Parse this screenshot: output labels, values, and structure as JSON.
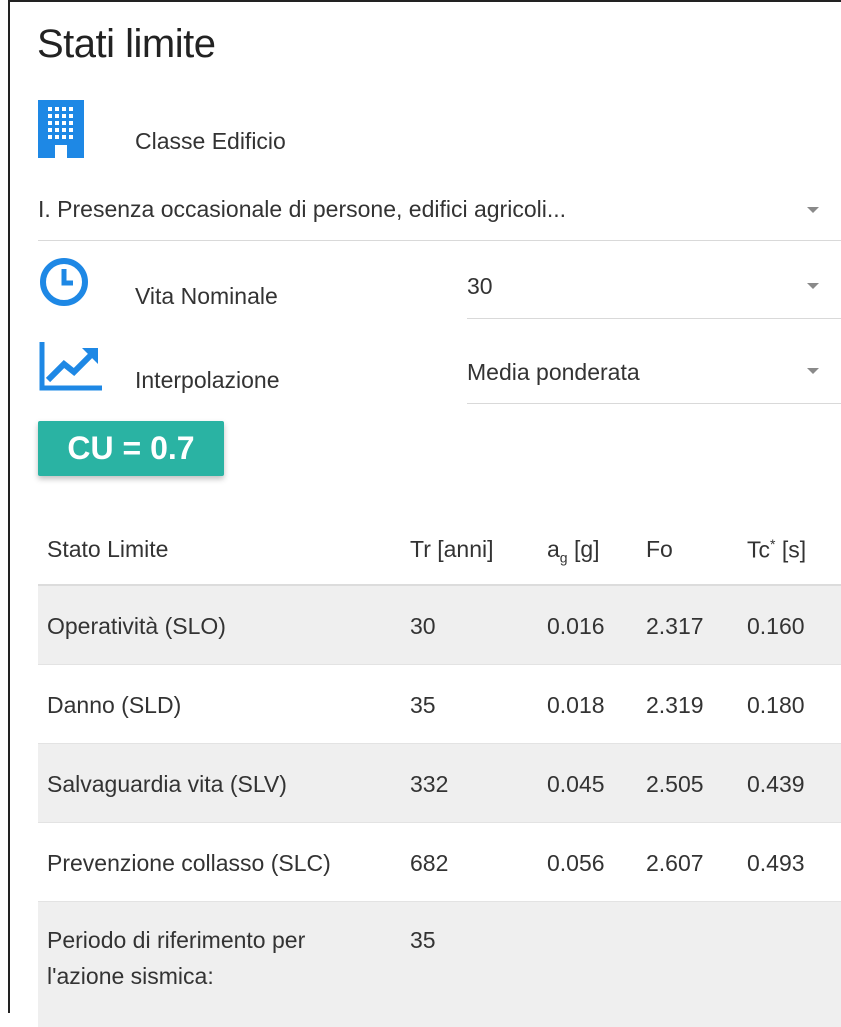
{
  "header": {
    "title": "Stati limite"
  },
  "building_class": {
    "label": "Classe Edificio",
    "icon": "building-icon",
    "selected": "I. Presenza occasionale di persone, edifici agricoli..."
  },
  "nominal_life": {
    "label": "Vita Nominale",
    "icon": "clock-icon",
    "selected": "30"
  },
  "interpolation": {
    "label": "Interpolazione",
    "icon": "trending-up-icon",
    "selected": "Media ponderata"
  },
  "cu_badge": {
    "text": "CU = 0.7",
    "color": "#2ab3a3"
  },
  "accent_color": "#1e88e5",
  "table": {
    "headers": {
      "stato": "Stato Limite",
      "tr": "Tr [anni]",
      "ag_main": "a",
      "ag_sub": "g",
      "ag_unit": " [g]",
      "fo": "Fo",
      "tc_main": "Tc",
      "tc_sup": "*",
      "tc_unit": " [s]"
    },
    "rows": [
      {
        "stato": "Operatività (SLO)",
        "tr": "30",
        "ag": "0.016",
        "fo": "2.317",
        "tc": "0.160"
      },
      {
        "stato": "Danno (SLD)",
        "tr": "35",
        "ag": "0.018",
        "fo": "2.319",
        "tc": "0.180"
      },
      {
        "stato": "Salvaguardia vita (SLV)",
        "tr": "332",
        "ag": "0.045",
        "fo": "2.505",
        "tc": "0.439"
      },
      {
        "stato": "Prevenzione collasso (SLC)",
        "tr": "682",
        "ag": "0.056",
        "fo": "2.607",
        "tc": "0.493"
      }
    ],
    "reference_period": {
      "label": "Periodo di riferimento per l'azione sismica:",
      "value": "35"
    }
  }
}
